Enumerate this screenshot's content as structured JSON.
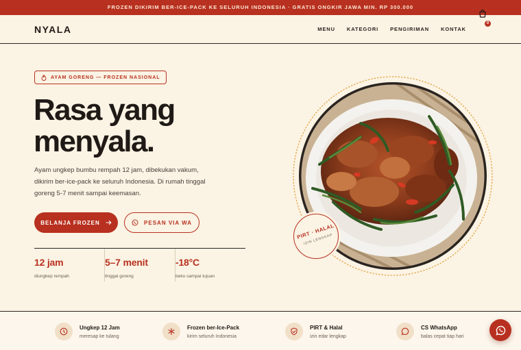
{
  "announcement": "FROZEN DIKIRIM BER-ICE-PACK KE SELURUH INDONESIA · GRATIS ONGKIR JAWA MIN. RP 300.000",
  "header": {
    "logo": "NYALA",
    "menu": [
      "MENU",
      "KATEGORI",
      "PENGIRIMAN",
      "KONTAK"
    ],
    "cart_count": "0"
  },
  "hero": {
    "tag": "AYAM GORENG — FROZEN NASIONAL",
    "headline_line1": "Rasa yang",
    "headline_line2": "menyala.",
    "lede": "Ayam ungkep bumbu rempah 12 jam, dibekukan vakum, dikirim ber-ice-pack ke seluruh Indonesia. Di rumah tinggal goreng 5-7 menit sampai keemasan.",
    "primary_cta": "BELANJA FROZEN",
    "secondary_cta": "PESAN VIA WA",
    "stats": [
      {
        "value": "12 jam",
        "label": "diungkep rempah"
      },
      {
        "value": "5–7 menit",
        "label": "tinggal goreng"
      },
      {
        "value": "-18°C",
        "label": "beku sampai tujuan"
      }
    ],
    "stamp_line1": "PIRT · HALAL",
    "stamp_line2": "IZIN LENGKAP"
  },
  "features": [
    {
      "icon": "clock-icon",
      "title": "Ungkep 12 Jam",
      "subtitle": "meresap ke tulang"
    },
    {
      "icon": "snowflake-icon",
      "title": "Frozen ber-Ice-Pack",
      "subtitle": "kirim seluruh Indonesia"
    },
    {
      "icon": "shield-check-icon",
      "title": "PIRT & Halal",
      "subtitle": "izin edar lengkap"
    },
    {
      "icon": "chat-icon",
      "title": "CS WhatsApp",
      "subtitle": "balas cepat tiap hari"
    }
  ],
  "colors": {
    "accent": "#b8301f",
    "background": "#fbf3e4",
    "ink": "#1f1a16"
  }
}
